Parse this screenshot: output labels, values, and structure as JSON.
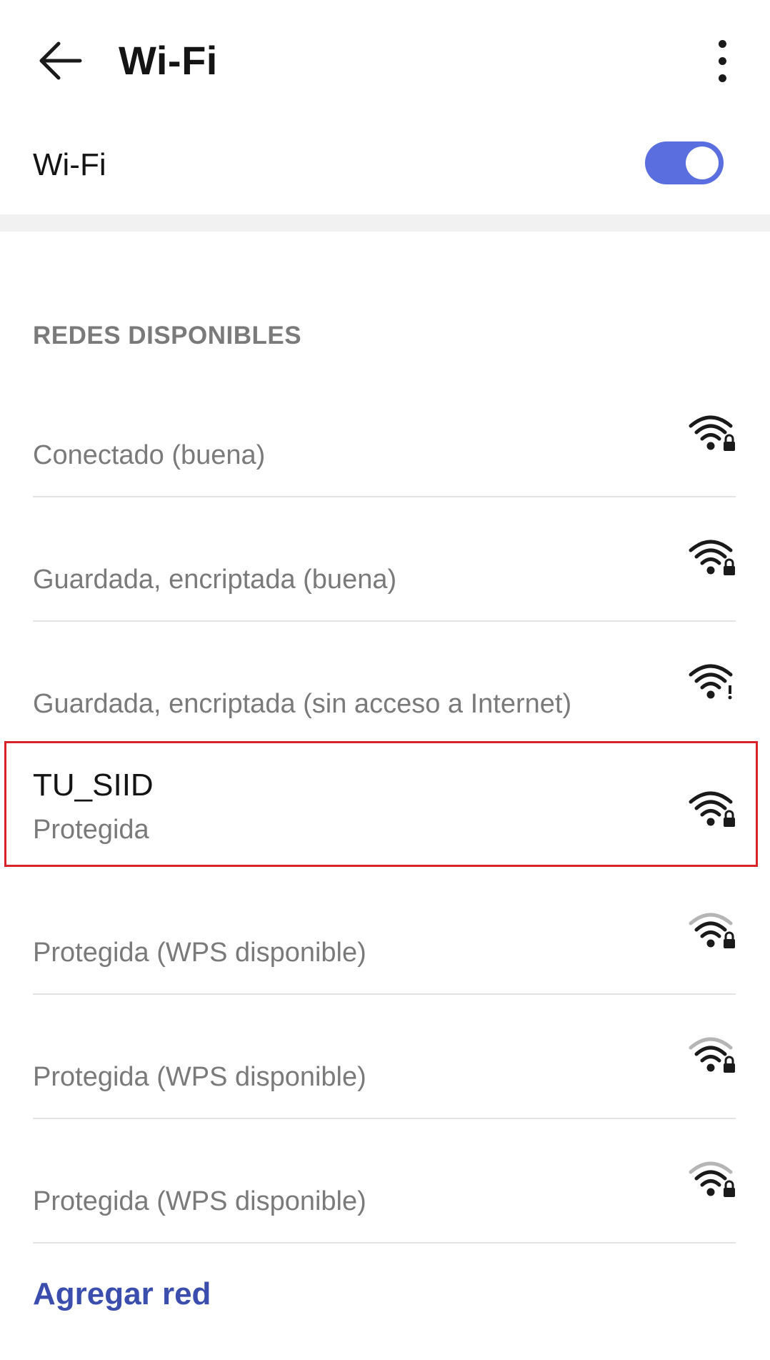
{
  "header": {
    "title": "Wi-Fi",
    "back_icon": "arrow-left-icon",
    "more_icon": "more-vertical-icon"
  },
  "wifi_toggle": {
    "label": "Wi-Fi",
    "state": "on",
    "color": "#5b6ee0"
  },
  "section": {
    "title": "REDES DISPONIBLES"
  },
  "networks": [
    {
      "name": "",
      "status": "Conectado  (buena)",
      "icon": "wifi-lock-icon",
      "signal": "full",
      "highlighted": false
    },
    {
      "name": "",
      "status": "Guardada, encriptada  (buena)",
      "icon": "wifi-lock-icon",
      "signal": "full",
      "highlighted": false
    },
    {
      "name": "",
      "status": "Guardada, encriptada  (sin acceso a Internet)",
      "icon": "wifi-alert-icon",
      "signal": "full",
      "highlighted": false
    },
    {
      "name": "TU_SIID",
      "status": "Protegida",
      "icon": "wifi-lock-icon",
      "signal": "full",
      "highlighted": true
    },
    {
      "name": "",
      "status": "Protegida (WPS disponible)",
      "icon": "wifi-lock-icon",
      "signal": "weak",
      "highlighted": false
    },
    {
      "name": "",
      "status": "Protegida (WPS disponible)",
      "icon": "wifi-lock-icon",
      "signal": "weak",
      "highlighted": false
    },
    {
      "name": "",
      "status": "Protegida (WPS disponible)",
      "icon": "wifi-lock-icon",
      "signal": "weak",
      "highlighted": false
    }
  ],
  "add_network": {
    "label": "Agregar red",
    "color": "#3b4eae"
  },
  "highlight_color": "#d8232a"
}
